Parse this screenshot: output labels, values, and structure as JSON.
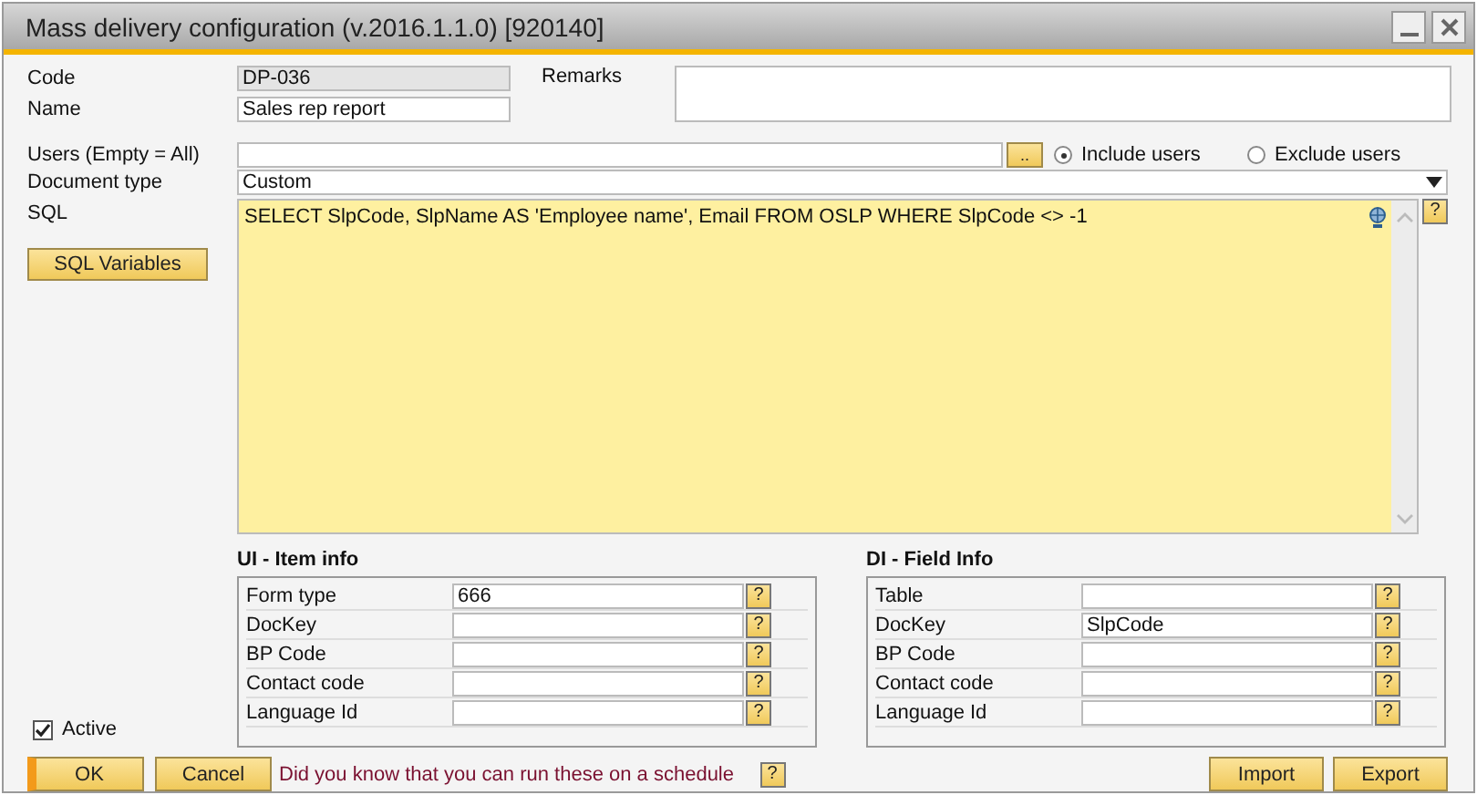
{
  "window": {
    "title": "Mass delivery configuration (v.2016.1.1.0) [920140]"
  },
  "code": {
    "label": "Code",
    "value": "DP-036",
    "disabled": true
  },
  "name": {
    "label": "Name",
    "value": "Sales rep report"
  },
  "remarks": {
    "label": "Remarks"
  },
  "users": {
    "label": "Users (Empty = All)",
    "browse": ".."
  },
  "user_mode": [
    {
      "label": "Include users",
      "selected": true
    },
    {
      "label": "Exclude users",
      "selected": false
    }
  ],
  "document_type": {
    "label": "Document type",
    "value": "Custom"
  },
  "sql": {
    "label": "SQL",
    "value": "SELECT SlpCode, SlpName AS 'Employee name', Email FROM OSLP WHERE SlpCode <> -1",
    "help": "?"
  },
  "sql_variables_button": "SQL Variables",
  "groups": [
    {
      "title": "UI - Item info",
      "rows": [
        {
          "label": "Form type",
          "value": "666",
          "help": "?"
        },
        {
          "label": "DocKey",
          "help": "?"
        },
        {
          "label": "BP Code",
          "help": "?"
        },
        {
          "label": "Contact code",
          "help": "?"
        },
        {
          "label": "Language Id",
          "help": "?"
        }
      ]
    },
    {
      "title": "DI - Field Info",
      "rows": [
        {
          "label": "Table",
          "help": "?"
        },
        {
          "label": "DocKey",
          "value": "SlpCode",
          "help": "?"
        },
        {
          "label": "BP Code",
          "help": "?"
        },
        {
          "label": "Contact code",
          "help": "?"
        },
        {
          "label": "Language Id",
          "help": "?"
        }
      ]
    }
  ],
  "active": {
    "label": "Active",
    "checked": true
  },
  "footer": {
    "ok": "OK",
    "cancel": "Cancel",
    "tip": "Did you know that you can run these on a schedule",
    "tip_help": "?",
    "import": "Import",
    "export": "Export"
  }
}
